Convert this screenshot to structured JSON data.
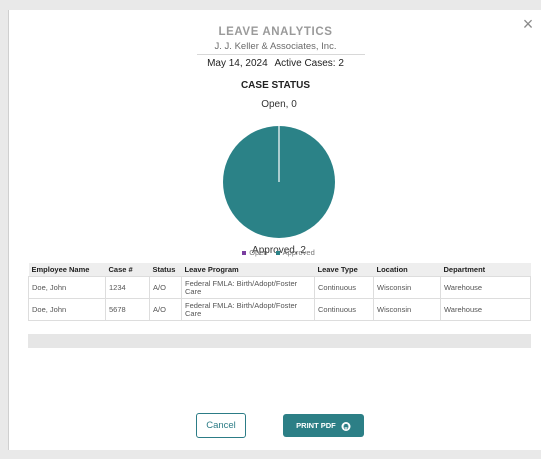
{
  "dialog": {
    "close_glyph": "×"
  },
  "header": {
    "title": "LEAVE ANALYTICS",
    "company": "J. J. Keller & Associates, Inc.",
    "date": "May 14, 2024",
    "active_cases": "Active Cases: 2"
  },
  "chart_data": {
    "type": "pie",
    "title": "CASE STATUS",
    "slices": [
      {
        "name": "Open",
        "value": 0,
        "color": "#7a3ea0",
        "label": "Open, 0"
      },
      {
        "name": "Approved",
        "value": 2,
        "color": "#2b8287",
        "label": "Approved, 2"
      }
    ],
    "legend": [
      "Open",
      "Approved"
    ],
    "legend_placement": "bottom"
  },
  "table": {
    "columns": [
      "Employee Name",
      "Case #",
      "Status",
      "Leave Program",
      "Leave Type",
      "Location",
      "Department"
    ],
    "rows": [
      [
        "Doe, John",
        "1234",
        "A/O",
        "Federal FMLA: Birth/Adopt/Foster Care",
        "Continuous",
        "Wisconsin",
        "Warehouse"
      ],
      [
        "Doe, John",
        "5678",
        "A/O",
        "Federal FMLA: Birth/Adopt/Foster Care",
        "Continuous",
        "Wisconsin",
        "Warehouse"
      ]
    ]
  },
  "footer": {
    "cancel_label": "Cancel",
    "print_label": "PRINT PDF",
    "print_icon": "printer-icon"
  },
  "colors": {
    "accent": "#2c7f86",
    "pie_approved": "#2b8287",
    "pie_open": "#7a3ea0"
  }
}
